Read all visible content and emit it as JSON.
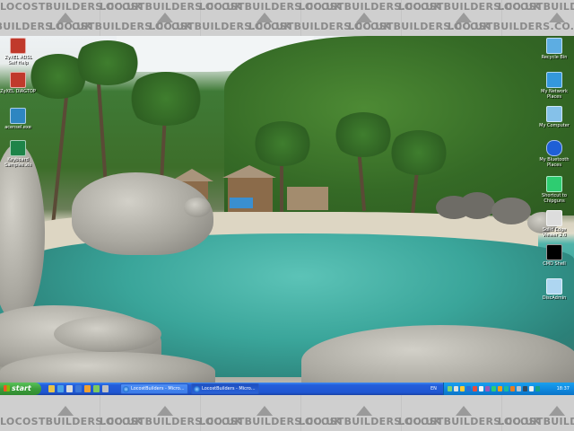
{
  "watermark": {
    "text": "LOCOSTBUILDERS.CO.UK"
  },
  "desktop_icons_left": [
    {
      "label": "ZyXEL ADSL Self Help",
      "icon": "network-router-icon",
      "color": "#c0392b"
    },
    {
      "label": "ZyXEL DIAGTOP",
      "icon": "network-router-icon",
      "color": "#c0392b"
    },
    {
      "label": "acensel.exe",
      "icon": "application-icon",
      "color": "#2e86c1"
    },
    {
      "label": "Keyboard Samples.xls",
      "icon": "spreadsheet-icon",
      "color": "#1e8449"
    }
  ],
  "desktop_icons_right": [
    {
      "label": "Recycle Bin",
      "icon": "recycle-bin-icon",
      "color": "#5dade2"
    },
    {
      "label": "My Network Places",
      "icon": "network-places-icon",
      "color": "#3498db"
    },
    {
      "label": "My Computer",
      "icon": "computer-icon",
      "color": "#85c1e9"
    },
    {
      "label": "My Bluetooth Places",
      "icon": "bluetooth-icon",
      "color": "#1f5fd6"
    },
    {
      "label": "Shortcut to Chipguns",
      "icon": "folder-icon",
      "color": "#2ecc71"
    },
    {
      "label": "Solid Edge Viewer 2.0",
      "icon": "viewer-icon",
      "color": "#dddddd"
    },
    {
      "label": "CMD Shell",
      "icon": "command-prompt-icon",
      "color": "#000000"
    },
    {
      "label": "DiscAdmin",
      "icon": "disc-icon",
      "color": "#aed6f1"
    }
  ],
  "taskbar": {
    "start_label": "start",
    "tasks": [
      {
        "label": "LocostBuilders - Micro...",
        "active": false
      },
      {
        "label": "LocostBuilders - Micro...",
        "active": true
      }
    ],
    "language": "EN",
    "clock": "18:37"
  },
  "colors": {
    "taskbar": "#245edb",
    "start_button": "#3c9e3c",
    "tray": "#0f8ae0"
  }
}
